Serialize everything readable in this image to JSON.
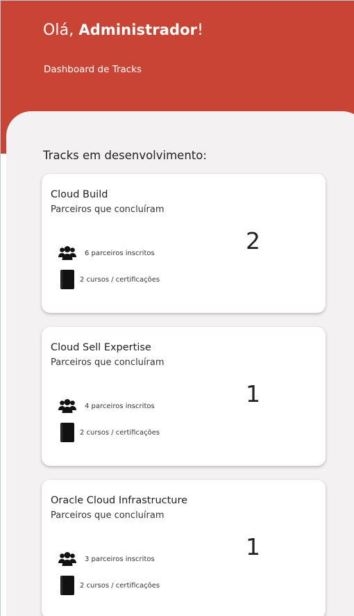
{
  "header": {
    "greeting_prefix": "Olá, ",
    "user_name": "Administrador",
    "greeting_suffix": "!",
    "subtitle": "Dashboard de Tracks",
    "color": "#c84535"
  },
  "main": {
    "section_title": "Tracks em desenvolvimento:",
    "background": "#f3f1f2",
    "tracks": [
      {
        "title": "Cloud Build",
        "subtitle": "Parceiros que concluíram",
        "completed_count": "2",
        "enrolled_text": "6 parceiros inscritos",
        "courses_text": "2 cursos / certificações"
      },
      {
        "title": "Cloud Sell Expertise",
        "subtitle": "Parceiros que concluíram",
        "completed_count": "1",
        "enrolled_text": "4 parceiros inscritos",
        "courses_text": "2 cursos / certificações"
      },
      {
        "title": "Oracle Cloud Infrastructure",
        "subtitle": "Parceiros que concluíram",
        "completed_count": "1",
        "enrolled_text": "3 parceiros inscritos",
        "courses_text": "2 cursos / certificações"
      }
    ]
  },
  "icons": {
    "enrolled": "users-icon",
    "courses": "book-icon"
  }
}
